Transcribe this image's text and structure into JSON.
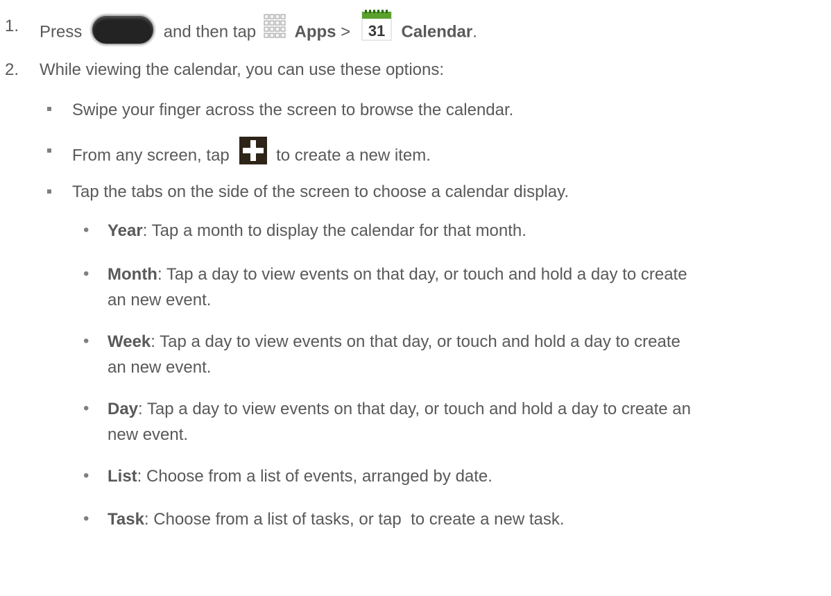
{
  "steps": [
    {
      "number": "1.",
      "press": "Press",
      "and_then_tap": "and then tap",
      "apps": "Apps",
      "sep": ">",
      "calendar": "Calendar",
      "end": ".",
      "home_key_icon": "home-key-icon",
      "apps_icon": "apps-grid-icon",
      "calendar_icon": "calendar-icon",
      "calendar_icon_day": "31"
    },
    {
      "number": "2.",
      "text": "While viewing the calendar, you can use these options:"
    }
  ],
  "options": [
    {
      "text": "Swipe your finger across the screen to browse the calendar."
    },
    {
      "before": "From any screen, tap",
      "after": "to create a new item.",
      "icon": "add-icon"
    },
    {
      "text": "Tap the tabs on the side of the screen to choose a calendar display."
    }
  ],
  "views": [
    {
      "term": "Year",
      "desc": ": Tap a month to display the calendar for that month."
    },
    {
      "term": "Month",
      "desc": ": Tap a day to view events on that day, or touch and hold a day to create",
      "desc2": "an new event."
    },
    {
      "term": "Week",
      "desc": ": Tap a day to view events on that day, or touch and hold a day to create",
      "desc2": "an new event."
    },
    {
      "term": "Day",
      "desc": ": Tap a day to view events on that day, or touch and hold a day to create an",
      "desc2": "new event."
    },
    {
      "term": "List",
      "desc": ": Choose from a list of events, arranged by date."
    },
    {
      "term": "Task",
      "desc": ": Choose from a list of tasks, or tap  to create a new task."
    }
  ],
  "colors": {
    "text": "#595959",
    "bullet": "#7f7f7f",
    "calendar_green": "#5aa02c"
  }
}
